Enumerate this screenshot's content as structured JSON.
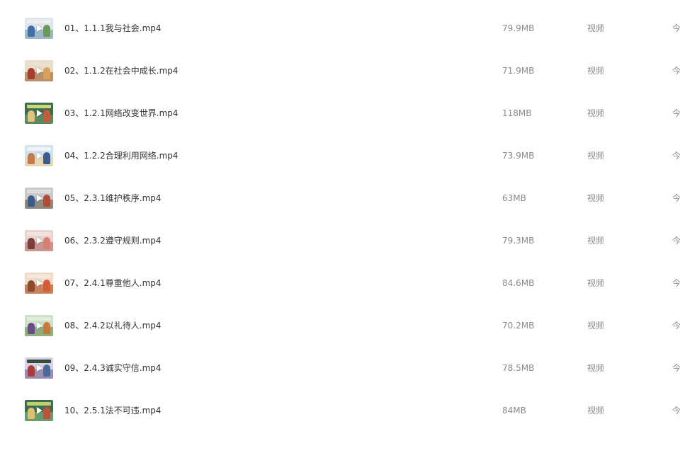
{
  "files": [
    {
      "name": "01、1.1.1我与社会.mp4",
      "size": "79.9MB",
      "type": "视频",
      "date": "今",
      "thumb": {
        "sky": "#dde6ee",
        "ground": "#9fb8c9",
        "fig1": "#3f6fa8",
        "fig2": "#6a9a5a",
        "banner": "#eeeeee"
      }
    },
    {
      "name": "02、1.1.2在社会中成长.mp4",
      "size": "71.9MB",
      "type": "视频",
      "date": "今",
      "thumb": {
        "sky": "#e9ddc8",
        "ground": "#b8916c",
        "fig1": "#a63c2e",
        "fig2": "#d9a25a",
        "banner": "#e8e2d4"
      }
    },
    {
      "name": "03、1.2.1网络改变世界.mp4",
      "size": "118MB",
      "type": "视频",
      "date": "今",
      "thumb": {
        "sky": "#3e6e52",
        "ground": "#5a8a5e",
        "fig1": "#e3c37a",
        "fig2": "#c45b3b",
        "banner": "#c9d87a"
      }
    },
    {
      "name": "04、1.2.2合理利用网络.mp4",
      "size": "73.9MB",
      "type": "视频",
      "date": "今",
      "thumb": {
        "sky": "#cfe2f0",
        "ground": "#e7d7b8",
        "fig1": "#c47a4a",
        "fig2": "#3b5d8a",
        "banner": "#f2f2f2"
      }
    },
    {
      "name": "05、2.3.1维护秩序.mp4",
      "size": "63MB",
      "type": "视频",
      "date": "今",
      "thumb": {
        "sky": "#c9c9c9",
        "ground": "#8f8a7a",
        "fig1": "#3a5a8c",
        "fig2": "#b24a3a",
        "banner": "#dedede"
      }
    },
    {
      "name": "06、2.3.2遵守规则.mp4",
      "size": "79.3MB",
      "type": "视频",
      "date": "今",
      "thumb": {
        "sky": "#e9d4cf",
        "ground": "#c99590",
        "fig1": "#7a3f3a",
        "fig2": "#d98070",
        "banner": "#f0e4e0"
      }
    },
    {
      "name": "07、2.4.1尊重他人.mp4",
      "size": "84.6MB",
      "type": "视频",
      "date": "今",
      "thumb": {
        "sky": "#f0dcc8",
        "ground": "#c7845c",
        "fig1": "#8a4a2e",
        "fig2": "#d65a3a",
        "banner": "#f4e8dc"
      }
    },
    {
      "name": "08、2.4.2以礼待人.mp4",
      "size": "70.2MB",
      "type": "视频",
      "date": "今",
      "thumb": {
        "sky": "#cfe0c8",
        "ground": "#8fae7e",
        "fig1": "#6a4a8a",
        "fig2": "#c8783a",
        "banner": "#e0ecd8"
      }
    },
    {
      "name": "09、2.4.3诚实守信.mp4",
      "size": "78.5MB",
      "type": "视频",
      "date": "今",
      "thumb": {
        "sky": "#d6d2e4",
        "ground": "#9a8fb2",
        "fig1": "#b03a3a",
        "fig2": "#4a6a9a",
        "banner": "#3a4a3a"
      }
    },
    {
      "name": "10、2.5.1法不可违.mp4",
      "size": "84MB",
      "type": "视频",
      "date": "今",
      "thumb": {
        "sky": "#3e6e4e",
        "ground": "#6a9a6a",
        "fig1": "#e0c070",
        "fig2": "#c05040",
        "banner": "#c0d070"
      }
    }
  ]
}
